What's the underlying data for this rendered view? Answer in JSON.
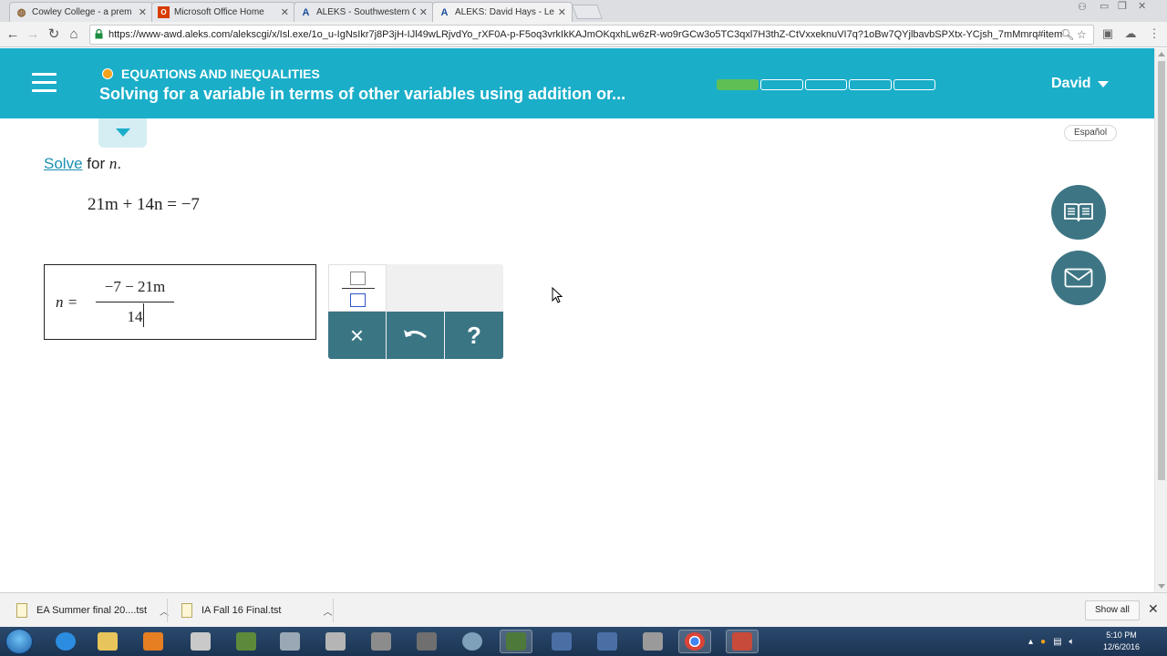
{
  "browser": {
    "tabs": [
      {
        "title": "Cowley College - a prem",
        "icon": "cowley-icon",
        "color": "#8a5a2b"
      },
      {
        "title": "Microsoft Office Home",
        "icon": "office-icon",
        "color": "#d83b01"
      },
      {
        "title": "ALEKS - Southwestern C",
        "icon": "aleks-icon",
        "color": "#1c4f9c"
      },
      {
        "title": "ALEKS: David Hays - Lea",
        "icon": "aleks-icon",
        "color": "#1c4f9c",
        "active": true
      }
    ],
    "url": "https://www-awd.aleks.com/alekscgi/x/Isl.exe/1o_u-IgNsIkr7j8P3jH-IJl49wLRjvdYo_rXF0A-p-F5oq3vrkIkKAJmOKqxhLw6zR-wo9rGCw3o5TC3qxl7H3thZ-CtVxxeknuVI7q?1oBw7QYjlbavbSPXtx-YCjsh_7mMmrq#item"
  },
  "header": {
    "topic": "EQUATIONS AND INEQUALITIES",
    "subtopic": "Solving for a variable in terms of other variables using addition or...",
    "progress": {
      "total_segments": 5,
      "completed_segments": 1
    },
    "user": "David",
    "colors": {
      "header_bg": "#1aaec9",
      "progress_done": "#5fbf55",
      "topic_dot": "#f5a21b"
    }
  },
  "language_button": "Español",
  "problem": {
    "solve_link": "Solve",
    "prompt_rest": "for",
    "variable": "n",
    "period": ".",
    "equation": "21m + 14n = −7"
  },
  "answer": {
    "lhs": "n =",
    "numerator": "−7 − 21m",
    "denominator": "14"
  },
  "keypad": {
    "fraction_button": "fraction-template",
    "clear_label": "×",
    "undo_label": "↶",
    "help_label": "?",
    "color": "#3a7584"
  },
  "side_buttons": [
    {
      "name": "ebook-button",
      "icon": "open-book-icon"
    },
    {
      "name": "message-button",
      "icon": "envelope-icon"
    }
  ],
  "downloads": {
    "items": [
      "EA Summer final 20....tst",
      "IA Fall 16 Final.tst"
    ],
    "show_all": "Show all"
  },
  "taskbar": {
    "time": "5:10 PM",
    "date": "12/6/2016"
  }
}
